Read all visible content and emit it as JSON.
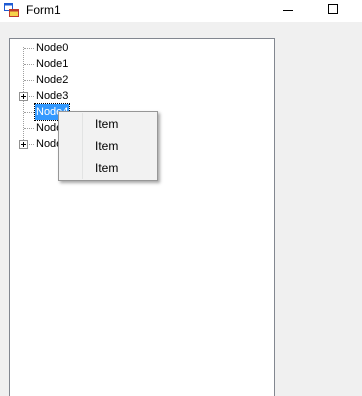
{
  "window": {
    "title": "Form1"
  },
  "tree": {
    "nodes": [
      {
        "label": "Node0",
        "expandable": false
      },
      {
        "label": "Node1",
        "expandable": false
      },
      {
        "label": "Node2",
        "expandable": false
      },
      {
        "label": "Node3",
        "expandable": true
      },
      {
        "label": "Node4",
        "expandable": false,
        "selected": true
      },
      {
        "label": "Node5",
        "expandable": false
      },
      {
        "label": "Node6",
        "expandable": true
      }
    ]
  },
  "context_menu": {
    "items": [
      "Item",
      "Item",
      "Item"
    ]
  },
  "colors": {
    "selection": "#3399ff",
    "border": "#828790",
    "menu_bg": "#f2f2f2"
  }
}
